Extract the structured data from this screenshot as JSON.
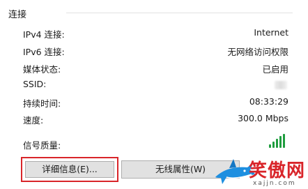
{
  "connection": {
    "section_title": "连接",
    "rows": [
      {
        "label": "IPv4 连接:",
        "value": "Internet"
      },
      {
        "label": "IPv6 连接:",
        "value": "无网络访问权限"
      },
      {
        "label": "媒体状态:",
        "value": "已启用"
      },
      {
        "label": "SSID:",
        "value": ""
      },
      {
        "label": "持续时间:",
        "value": "08:33:29"
      },
      {
        "label": "速度:",
        "value": "300.0 Mbps"
      },
      {
        "label": "信号质量:",
        "value": ""
      }
    ],
    "signal_icon": "signal-strength-icon",
    "signal_color": "#1f9d3f"
  },
  "buttons": {
    "details_label": "详细信息(E)...",
    "wireless_label": "无线属性(W)"
  },
  "highlight_color": "#d9252a",
  "watermark": {
    "text": "笑傲网",
    "subtext": "xajjn.com",
    "icon": "shark-logo"
  }
}
